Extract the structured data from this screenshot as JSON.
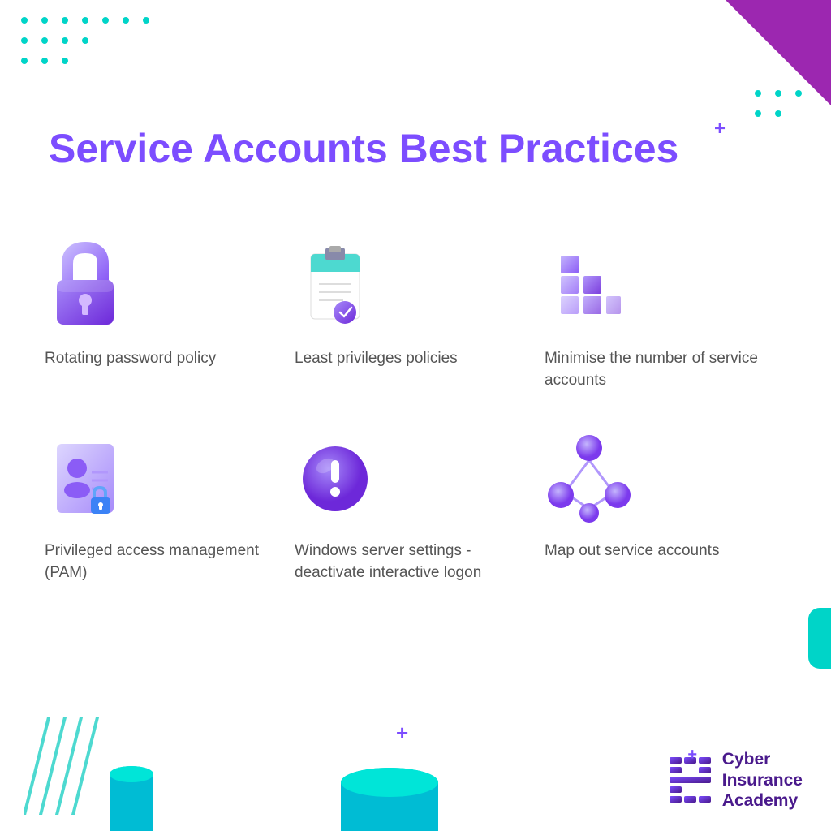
{
  "title": "Service Accounts Best Practices",
  "cards": [
    {
      "id": "rotating-password",
      "label": "Rotating password policy",
      "icon": "lock"
    },
    {
      "id": "least-privileges",
      "label": "Least privileges policies",
      "icon": "clipboard"
    },
    {
      "id": "minimise-accounts",
      "label": "Minimise the number of service accounts",
      "icon": "blocks"
    },
    {
      "id": "pam",
      "label": "Privileged access management (PAM)",
      "icon": "id-lock"
    },
    {
      "id": "windows-server",
      "label": "Windows server settings - deactivate interactive logon",
      "icon": "alert-circle"
    },
    {
      "id": "map-accounts",
      "label": "Map out service accounts",
      "icon": "network"
    }
  ],
  "logo": {
    "name": "Cyber Insurance Academy",
    "lines": [
      "Cyber",
      "Insurance",
      "Academy"
    ]
  },
  "colors": {
    "purple": "#7c4dff",
    "dark_purple": "#4a1a8c",
    "teal": "#00d4c8",
    "triangle": "#9c27b0",
    "text": "#555555"
  }
}
